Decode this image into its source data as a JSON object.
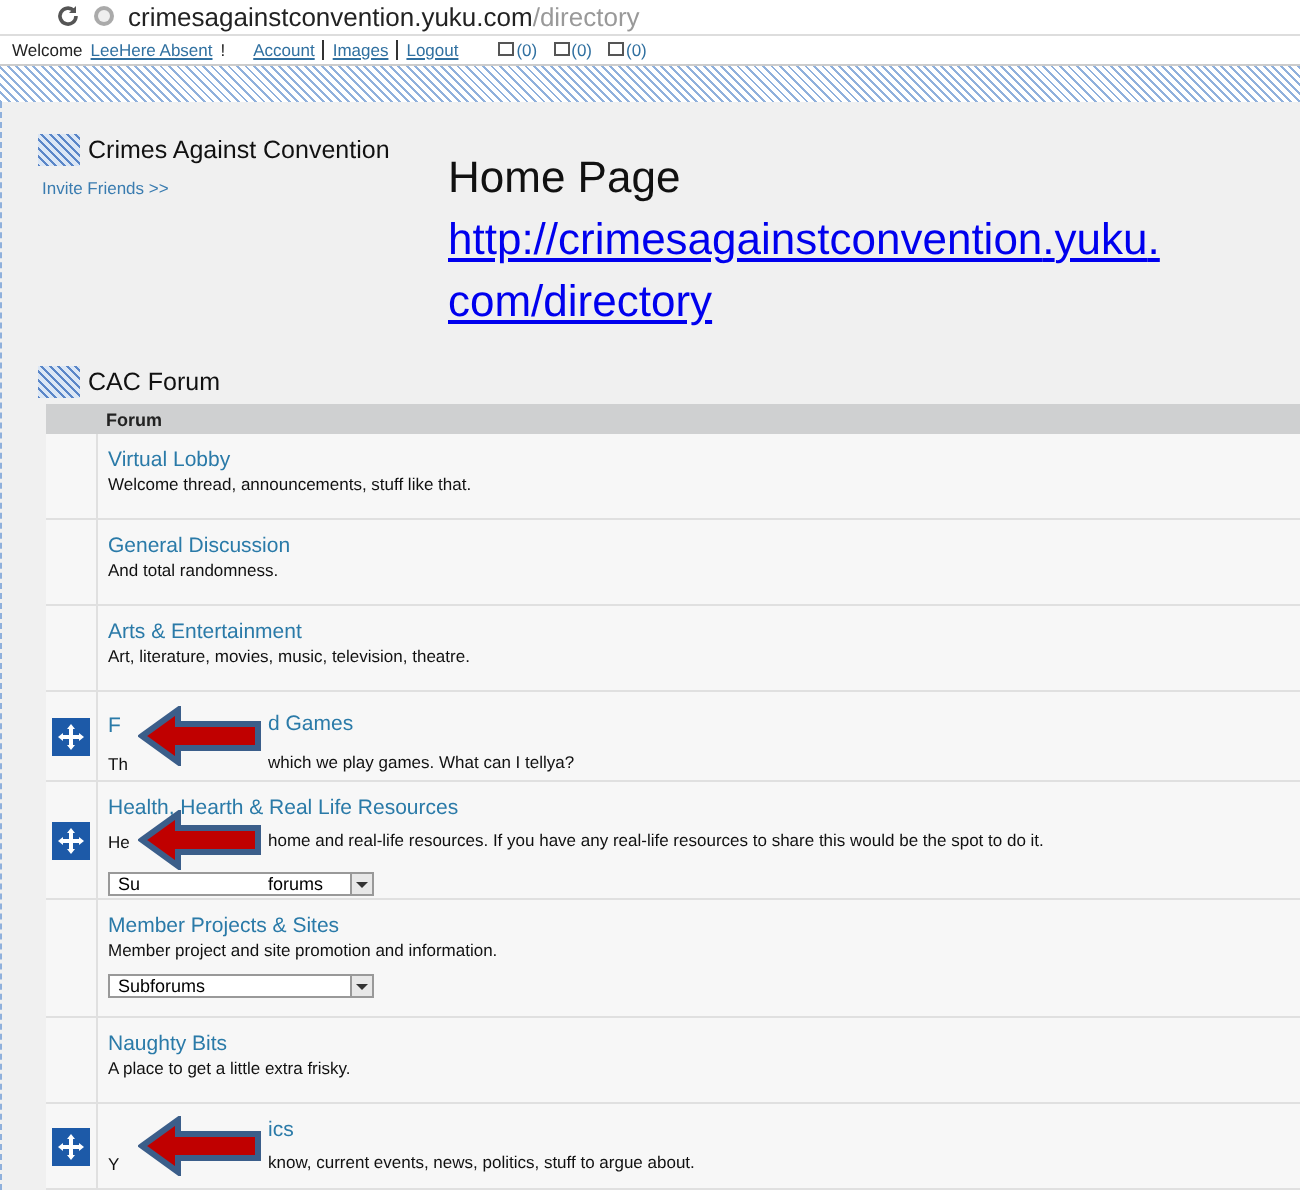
{
  "browser": {
    "url_host": "crimesagainstconvention.yuku.com",
    "url_path": "/directory"
  },
  "userbar": {
    "welcome": "Welcome",
    "username": "LeeHere Absent",
    "exclaim": "!",
    "links": [
      "Account",
      "Images",
      "Logout"
    ],
    "counters": [
      "(0)",
      "(0)",
      "(0)"
    ]
  },
  "site": {
    "title": "Crimes Against Convention",
    "invite": "Invite Friends >>"
  },
  "callout": {
    "heading": "Home Page",
    "link": "http://crimesagainstconvention.yuku.com/directory"
  },
  "section": {
    "title": "CAC Forum",
    "column_header": "Forum"
  },
  "forums": [
    {
      "title": {
        "text": "Virtual Lobby"
      },
      "description": {
        "text": "Welcome thread, announcements, stuff like that."
      },
      "has_icon": false,
      "arrow": false
    },
    {
      "title": {
        "text": "General Discussion"
      },
      "description": {
        "text": "And total randomness."
      },
      "has_icon": false,
      "arrow": false
    },
    {
      "title": {
        "text": "Arts & Entertainment"
      },
      "description": {
        "text": "Art, literature, movies, music, television, theatre."
      },
      "has_icon": false,
      "arrow": false
    },
    {
      "title": {
        "before": "F",
        "after": "d Games"
      },
      "description": {
        "before": "Th",
        "after": "which we play games. What can I tellya?"
      },
      "has_icon": true,
      "arrow": true
    },
    {
      "title": {
        "text": "Health, Hearth & Real Life Resources"
      },
      "description": {
        "before": "He",
        "after": "home and real-life resources. If you have any real-life resources to share this would be the spot to do it."
      },
      "select": {
        "before": "Su",
        "after": "forums"
      },
      "has_icon": true,
      "arrow": true
    },
    {
      "title": {
        "text": "Member Projects & Sites"
      },
      "description": {
        "text": "Member project and site promotion and information."
      },
      "select": {
        "text": "Subforums"
      },
      "has_icon": false,
      "arrow": false
    },
    {
      "title": {
        "text": "Naughty Bits"
      },
      "description": {
        "text": "A place to get a little extra frisky."
      },
      "has_icon": false,
      "arrow": false
    },
    {
      "title": {
        "after": "ics"
      },
      "description": {
        "before": "Y",
        "after": "know, current events, news, politics, stuff to argue about."
      },
      "has_icon": true,
      "arrow": true
    }
  ]
}
